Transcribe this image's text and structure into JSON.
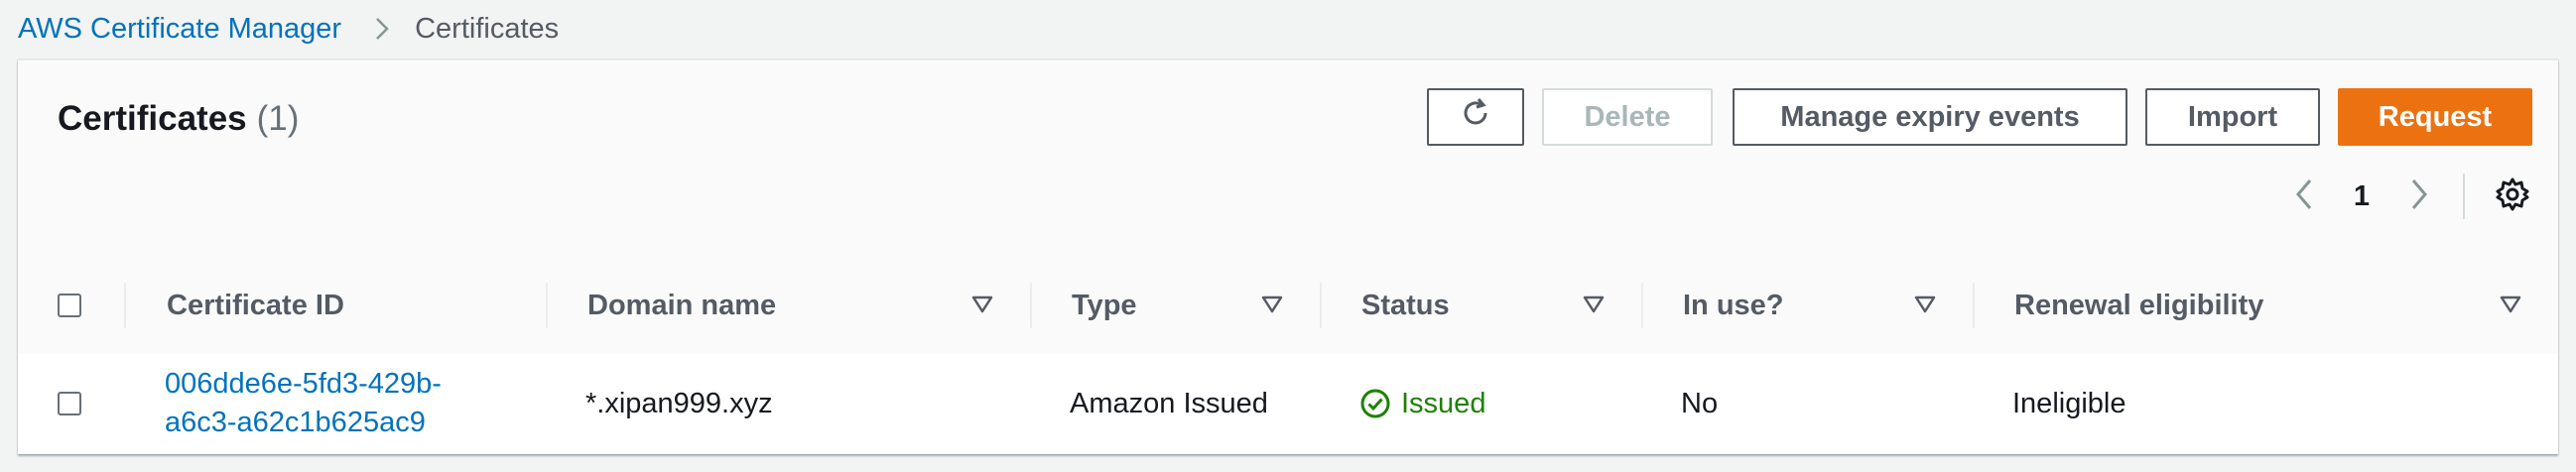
{
  "breadcrumb": {
    "parent": "AWS Certificate Manager",
    "current": "Certificates"
  },
  "header": {
    "title": "Certificates",
    "count": "(1)",
    "buttons": {
      "delete": "Delete",
      "manage_expiry": "Manage expiry events",
      "import": "Import",
      "request": "Request"
    }
  },
  "pagination": {
    "page": "1"
  },
  "table": {
    "columns": [
      "Certificate ID",
      "Domain name",
      "Type",
      "Status",
      "In use?",
      "Renewal eligibility"
    ],
    "rows": [
      {
        "certificate_id_line1": "006dde6e-5fd3-429b-",
        "certificate_id_line2": "a6c3-a62c1b625ac9",
        "domain_name": "*.xipan999.xyz",
        "type": "Amazon Issued",
        "status": "Issued",
        "in_use": "No",
        "renewal_eligibility": "Ineligible"
      }
    ]
  },
  "colors": {
    "link": "#0073bb",
    "primary_button": "#ec7211",
    "success": "#1d8102",
    "background": "#f2f3f3"
  },
  "icons": [
    "chevron-right-icon",
    "refresh-icon",
    "chevron-left-icon",
    "chevron-right-icon",
    "gear-icon",
    "caret-down-icon",
    "check-circle-icon"
  ]
}
